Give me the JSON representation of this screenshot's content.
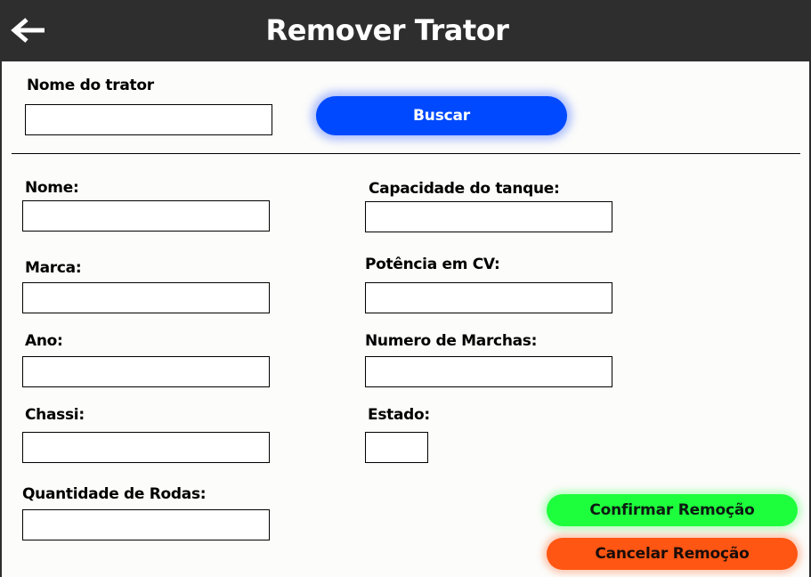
{
  "header": {
    "title": "Remover Trator",
    "back_icon": "arrow-left-icon"
  },
  "search": {
    "label": "Nome do trator",
    "value": "",
    "button_label": "Buscar"
  },
  "fields": {
    "nome": {
      "label": "Nome:",
      "value": ""
    },
    "marca": {
      "label": "Marca:",
      "value": ""
    },
    "ano": {
      "label": "Ano:",
      "value": ""
    },
    "chassi": {
      "label": "Chassi:",
      "value": ""
    },
    "quantidade_rodas": {
      "label": "Quantidade de Rodas:",
      "value": ""
    },
    "capacidade_tanque": {
      "label": "Capacidade do tanque:",
      "value": ""
    },
    "potencia_cv": {
      "label": "Potência em CV:",
      "value": ""
    },
    "numero_marchas": {
      "label": "Numero de Marchas:",
      "value": ""
    },
    "estado": {
      "label": "Estado:",
      "value": ""
    }
  },
  "actions": {
    "confirm_label": "Confirmar Remoção",
    "cancel_label": "Cancelar Remoção"
  },
  "colors": {
    "header_bg": "#2e2e2e",
    "content_bg": "#fcfcfa",
    "search_button": "#0049ff",
    "confirm_button": "#1dff3c",
    "cancel_button": "#ff5613"
  }
}
